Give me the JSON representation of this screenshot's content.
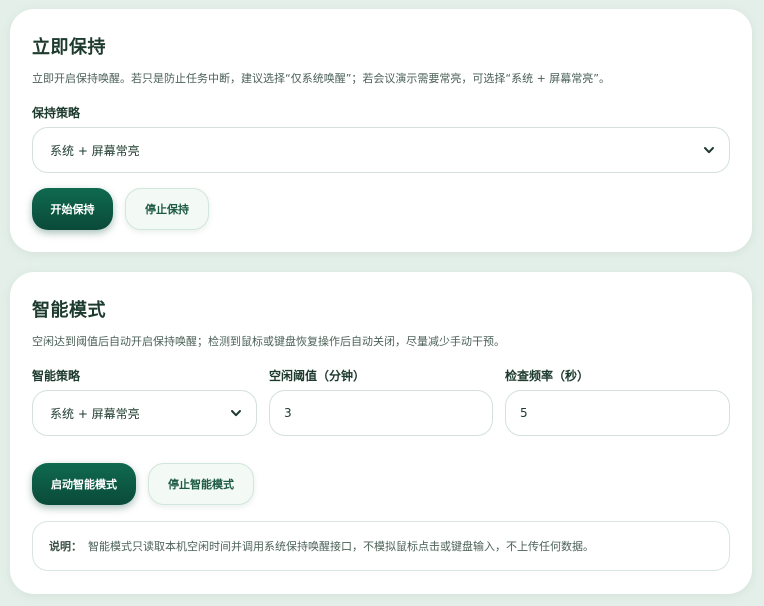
{
  "keep_now": {
    "title": "立即保持",
    "description": "立即开启保持唤醒。若只是防止任务中断，建议选择“仅系统唤醒”；若会议演示需要常亮，可选择“系统 + 屏幕常亮”。",
    "strategy_label": "保持策略",
    "strategy_value": "系统 + 屏幕常亮",
    "start_button": "开始保持",
    "stop_button": "停止保持"
  },
  "smart_mode": {
    "title": "智能模式",
    "description": "空闲达到阈值后自动开启保持唤醒；检测到鼠标或键盘恢复操作后自动关闭，尽量减少手动干预。",
    "strategy_label": "智能策略",
    "strategy_value": "系统 + 屏幕常亮",
    "idle_label": "空闲阈值（分钟）",
    "idle_value": "3",
    "check_label": "检查频率（秒）",
    "check_value": "5",
    "start_button": "启动智能模式",
    "stop_button": "停止智能模式",
    "note_label": "说明：",
    "note_text": "智能模式只读取本机空闲时间并调用系统保持唤醒接口，不模拟鼠标点击或键盘输入，不上传任何数据。"
  },
  "colors": {
    "background": "#e4efe9",
    "primary": "#0f6a4f",
    "primary_dark": "#0a4a38",
    "secondary_bg": "#f3faf6"
  },
  "icons": {
    "select_arrow": "chevron-down-icon"
  }
}
